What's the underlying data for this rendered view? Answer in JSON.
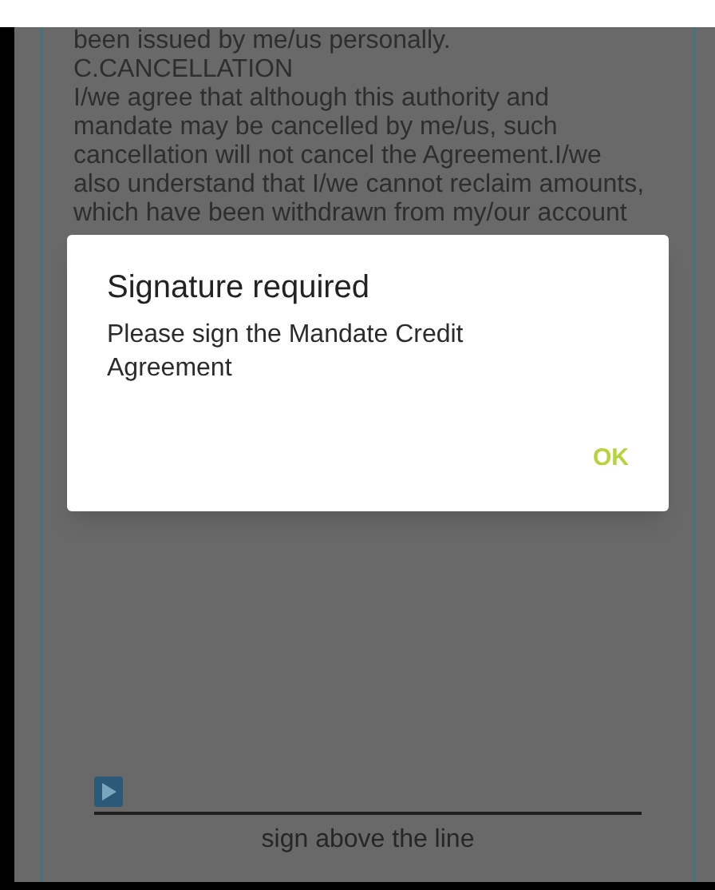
{
  "document": {
    "lines": [
      "been issued by me/us personally.",
      "C.CANCELLATION",
      "I/we agree that although this authority and",
      "mandate may be cancelled by me/us, such",
      "cancellation will not cancel the Agreement.I/we",
      "also understand that I/we cannot reclaim amounts,",
      "which have been withdrawn from my/our account"
    ]
  },
  "signature": {
    "caption": "sign above the line"
  },
  "dialog": {
    "title": "Signature required",
    "message": "Please sign the Mandate Credit Agreement",
    "buttons": [
      "OK"
    ]
  }
}
